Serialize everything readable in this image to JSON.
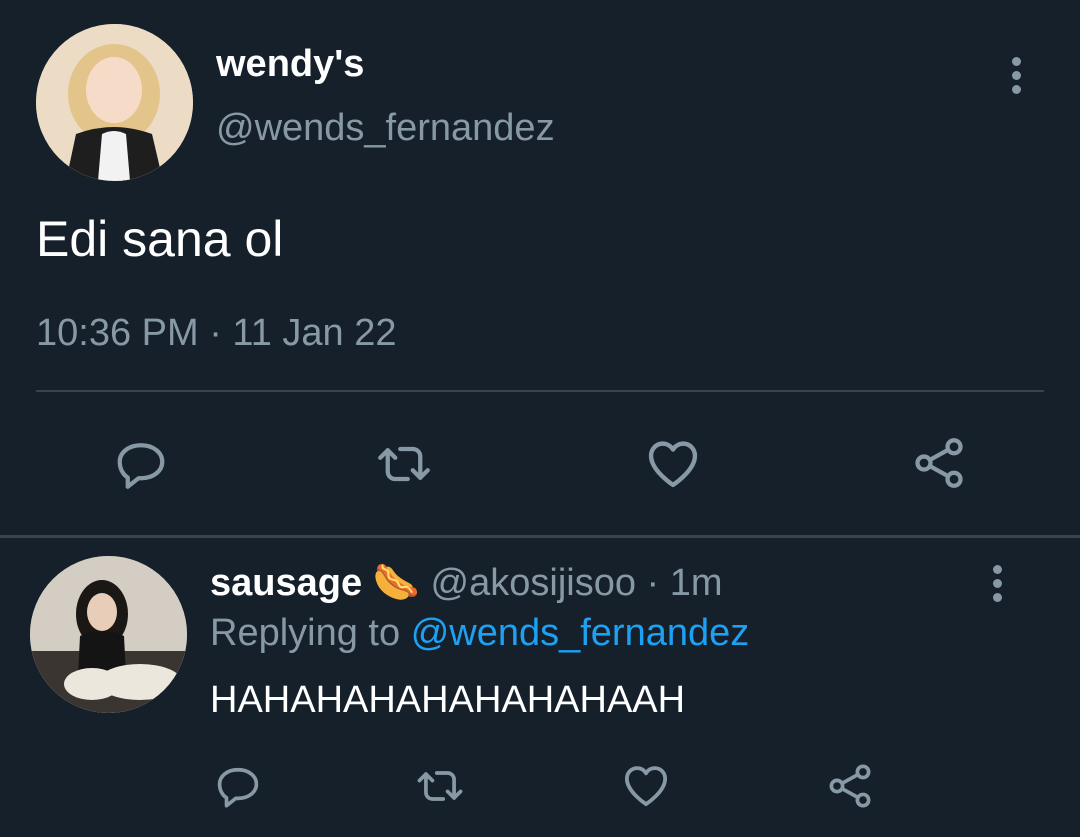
{
  "tweet": {
    "display_name": "wendy's",
    "handle": "@wends_fernandez",
    "text": "Edi sana ol",
    "timestamp": "10:36 PM · 11 Jan 22",
    "actions": [
      "reply-icon",
      "retweet-icon",
      "like-icon",
      "share-icon"
    ]
  },
  "reply": {
    "display_name": "sausage",
    "emoji": "🌭",
    "handle": "@akosijisoo",
    "separator": "·",
    "time": "1m",
    "replying_prefix": "Replying to",
    "replying_to": "@wends_fernandez",
    "text": "HAHAHAHAHAHAHAHAAH",
    "actions": [
      "reply-icon",
      "retweet-icon",
      "like-icon",
      "share-icon"
    ]
  },
  "colors": {
    "background": "#15202b",
    "muted": "#8899a6",
    "link": "#1da1f2",
    "divider": "#38444d"
  }
}
